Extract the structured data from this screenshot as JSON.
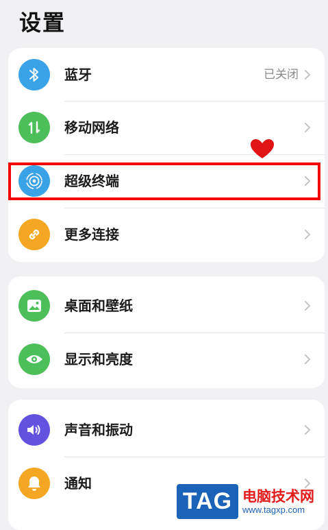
{
  "header": {
    "title": "设置"
  },
  "groups": [
    {
      "items": [
        {
          "label": "蓝牙",
          "value": "已关闭",
          "icon": "bluetooth-icon",
          "color": "#3aa3e8"
        },
        {
          "label": "移动网络",
          "value": "",
          "icon": "mobile-data-icon",
          "color": "#4cbf5a"
        },
        {
          "label": "超级终端",
          "value": "",
          "icon": "super-device-icon",
          "color": "#3aa3e8"
        },
        {
          "label": "更多连接",
          "value": "",
          "icon": "link-icon",
          "color": "#f5a623"
        }
      ]
    },
    {
      "items": [
        {
          "label": "桌面和壁纸",
          "value": "",
          "icon": "wallpaper-icon",
          "color": "#4cbf5a"
        },
        {
          "label": "显示和亮度",
          "value": "",
          "icon": "eye-icon",
          "color": "#4cbf5a"
        }
      ]
    },
    {
      "items": [
        {
          "label": "声音和振动",
          "value": "",
          "icon": "speaker-icon",
          "color": "#6352e0"
        },
        {
          "label": "通知",
          "value": "",
          "icon": "bell-icon",
          "color": "#f5a623"
        }
      ]
    }
  ],
  "annotation": {
    "highlight_color": "#f20000",
    "heart_color": "#e01414"
  },
  "watermark": {
    "logo": "TAG",
    "site": "电脑技术网",
    "url": "www.tagxp.com"
  }
}
